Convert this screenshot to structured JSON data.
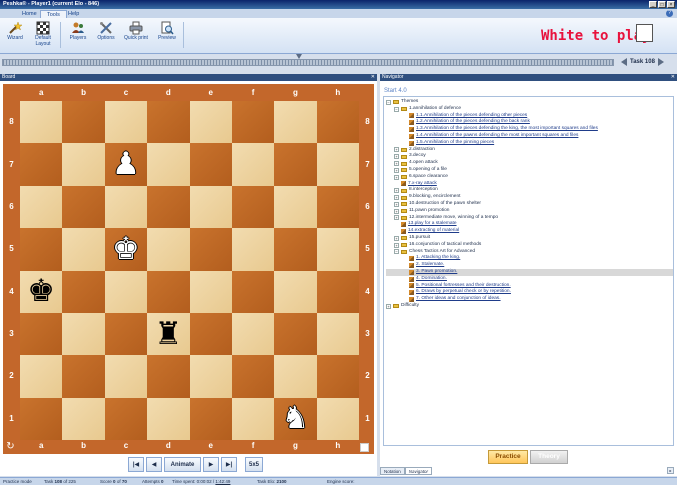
{
  "window": {
    "title": "Peshka® - Player1 (current Elo - 846)",
    "controls": [
      "_",
      "□",
      "×"
    ]
  },
  "menu": {
    "tabs": [
      "Home",
      "Tools",
      "Help"
    ],
    "active": "Tools",
    "help_icon": "?"
  },
  "ribbon": {
    "buttons": [
      {
        "label": "Wizard",
        "icon": "wizard-icon"
      },
      {
        "label": "Default Layout",
        "icon": "layout-icon"
      },
      {
        "label": "Players",
        "icon": "players-icon"
      },
      {
        "label": "Options",
        "icon": "options-icon"
      },
      {
        "label": "Quick print",
        "icon": "print-icon"
      },
      {
        "label": "Preview",
        "icon": "preview-icon"
      }
    ]
  },
  "status_text": "White to play",
  "task_nav": {
    "label": "Task 108"
  },
  "board_panel": {
    "title": "Board"
  },
  "navigator_panel": {
    "title": "Navigator"
  },
  "board": {
    "files": [
      "a",
      "b",
      "c",
      "d",
      "e",
      "f",
      "g",
      "h"
    ],
    "ranks": [
      "8",
      "7",
      "6",
      "5",
      "4",
      "3",
      "2",
      "1"
    ],
    "pieces": [
      {
        "square": "c7",
        "glyph": "♟",
        "color": "white",
        "name": "white-pawn"
      },
      {
        "square": "c5",
        "glyph": "♚",
        "color": "white",
        "name": "white-king"
      },
      {
        "square": "a4",
        "glyph": "♚",
        "color": "black",
        "name": "black-king"
      },
      {
        "square": "d3",
        "glyph": "♜",
        "color": "black",
        "name": "black-rook"
      },
      {
        "square": "g1",
        "glyph": "♞",
        "color": "white",
        "name": "white-knight"
      }
    ],
    "colors": {
      "light": "#eed3a0",
      "dark": "#c0682a",
      "frame": "#c3672b"
    }
  },
  "controls": {
    "first": "|◀",
    "prev": "◀",
    "animate": "Animate",
    "next": "▶",
    "last": "▶|",
    "size": "5x5"
  },
  "navigator": {
    "start": "Start 4.0",
    "tree": [
      {
        "level": 0,
        "pm": "−",
        "kind": "folder",
        "text": "Themes"
      },
      {
        "level": 1,
        "pm": "−",
        "kind": "folder",
        "text": "1.annihilation of defence"
      },
      {
        "level": 2,
        "kind": "task",
        "link": true,
        "text": "1.1.Annihilation of the pieces defending other pieces"
      },
      {
        "level": 2,
        "kind": "task",
        "link": true,
        "text": "1.2.Annihilation of the pieces defending the back rank"
      },
      {
        "level": 2,
        "kind": "task",
        "link": true,
        "text": "1.3.Annihilation of the pieces defending the king, the most important squares and files"
      },
      {
        "level": 2,
        "kind": "task",
        "link": true,
        "text": "1.4.Annihilation of the pawns defending the most important squares and files"
      },
      {
        "level": 2,
        "kind": "task",
        "link": true,
        "text": "1.5.Annihilation of the pinning pieces"
      },
      {
        "level": 1,
        "pm": "+",
        "kind": "folder",
        "text": "2.distraction"
      },
      {
        "level": 1,
        "pm": "+",
        "kind": "folder",
        "text": "3.decoy"
      },
      {
        "level": 1,
        "pm": "+",
        "kind": "folder",
        "text": "4.open attack"
      },
      {
        "level": 1,
        "pm": "+",
        "kind": "folder",
        "text": "5.opening of a file"
      },
      {
        "level": 1,
        "pm": "+",
        "kind": "folder",
        "text": "6.space clearance"
      },
      {
        "level": 1,
        "kind": "task",
        "link": true,
        "text": "7.x-ray attack"
      },
      {
        "level": 1,
        "pm": "+",
        "kind": "folder",
        "text": "8.interception"
      },
      {
        "level": 1,
        "pm": "+",
        "kind": "folder",
        "text": "9.blocking, encirclement"
      },
      {
        "level": 1,
        "pm": "+",
        "kind": "folder",
        "text": "10.destruction of the pawn shelter"
      },
      {
        "level": 1,
        "pm": "+",
        "kind": "folder",
        "text": "11.pawn promotion"
      },
      {
        "level": 1,
        "pm": "+",
        "kind": "folder",
        "text": "12.intermediate move, winning of a tempo"
      },
      {
        "level": 1,
        "kind": "task",
        "link": true,
        "text": "13.play for a stalemate"
      },
      {
        "level": 1,
        "kind": "task",
        "link": true,
        "text": "14.extracting of material"
      },
      {
        "level": 1,
        "pm": "+",
        "kind": "folder",
        "text": "15.pursuit"
      },
      {
        "level": 1,
        "pm": "+",
        "kind": "folder",
        "text": "16.conjunction of tactical methods"
      },
      {
        "level": 1,
        "pm": "−",
        "kind": "folder",
        "text": "Chess Tactics Art for Advanced"
      },
      {
        "level": 2,
        "kind": "task",
        "link": true,
        "text": "1. Attacking the king."
      },
      {
        "level": 2,
        "kind": "task",
        "link": true,
        "text": "2. Stalemate."
      },
      {
        "level": 2,
        "kind": "task",
        "link": true,
        "selected": true,
        "text": "3. Pawn promotion."
      },
      {
        "level": 2,
        "kind": "task",
        "link": true,
        "text": "4. Domination."
      },
      {
        "level": 2,
        "kind": "task",
        "link": true,
        "text": "5. Positional fortresses and their destruction."
      },
      {
        "level": 2,
        "kind": "task",
        "link": true,
        "text": "6. Draws by perpetual check or by repetition."
      },
      {
        "level": 2,
        "kind": "task",
        "link": true,
        "text": "7. Other ideas and conjunction of ideas."
      },
      {
        "level": 0,
        "pm": "+",
        "kind": "folder",
        "text": "Difficulty"
      }
    ],
    "practice_label": "Practice",
    "theory_label": "Theory",
    "tabs": [
      "Notation",
      "Navigator"
    ],
    "active_tab": "Navigator"
  },
  "statusbar": {
    "mode": "Practice mode",
    "task_label": "Task",
    "task_num": "108",
    "task_of": "of 225",
    "score_label": "Score",
    "score_val": "0",
    "score_of": "of",
    "score_total": "70",
    "attempts_label": "Attempts",
    "attempts_val": "0",
    "time_label": "Time spent:",
    "time_val": "0:00:02",
    "time_sep": "/",
    "time_total": "1:42:49",
    "elo_label": "Task Elo:",
    "elo_val": "2100",
    "engine_label": "Engine score:"
  }
}
